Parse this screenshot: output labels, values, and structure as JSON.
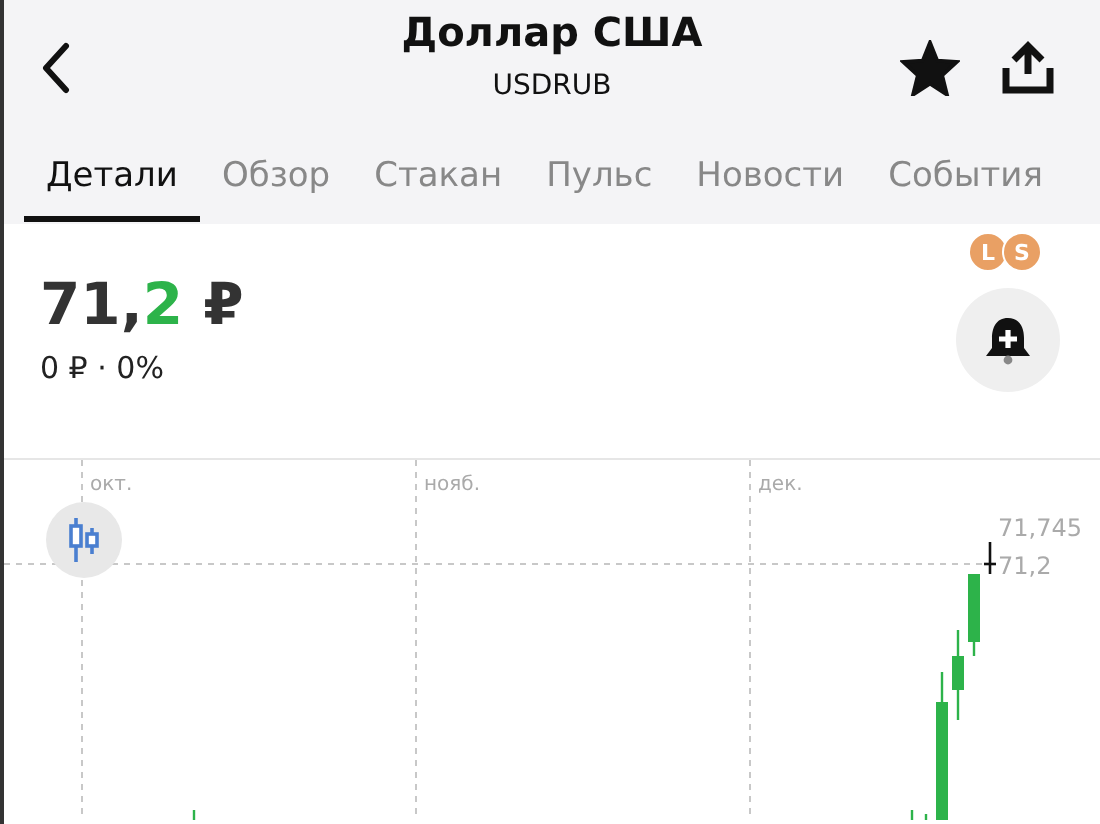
{
  "header": {
    "title": "Доллар США",
    "subtitle": "USDRUB",
    "favorite": true
  },
  "tabs": [
    {
      "label": "Детали",
      "selected": true
    },
    {
      "label": "Обзор",
      "selected": false
    },
    {
      "label": "Стакан",
      "selected": false
    },
    {
      "label": "Пульс",
      "selected": false
    },
    {
      "label": "Новости",
      "selected": false
    },
    {
      "label": "События",
      "selected": false
    }
  ],
  "badges": [
    "L",
    "S"
  ],
  "price": {
    "whole": "71,",
    "last_digit": "2",
    "currency": "₽",
    "change": "0 ₽ · 0%"
  },
  "chart": {
    "months": [
      "окт.",
      "нояб.",
      "дек."
    ],
    "high_label": "71,745",
    "last_label": "71,2"
  }
}
